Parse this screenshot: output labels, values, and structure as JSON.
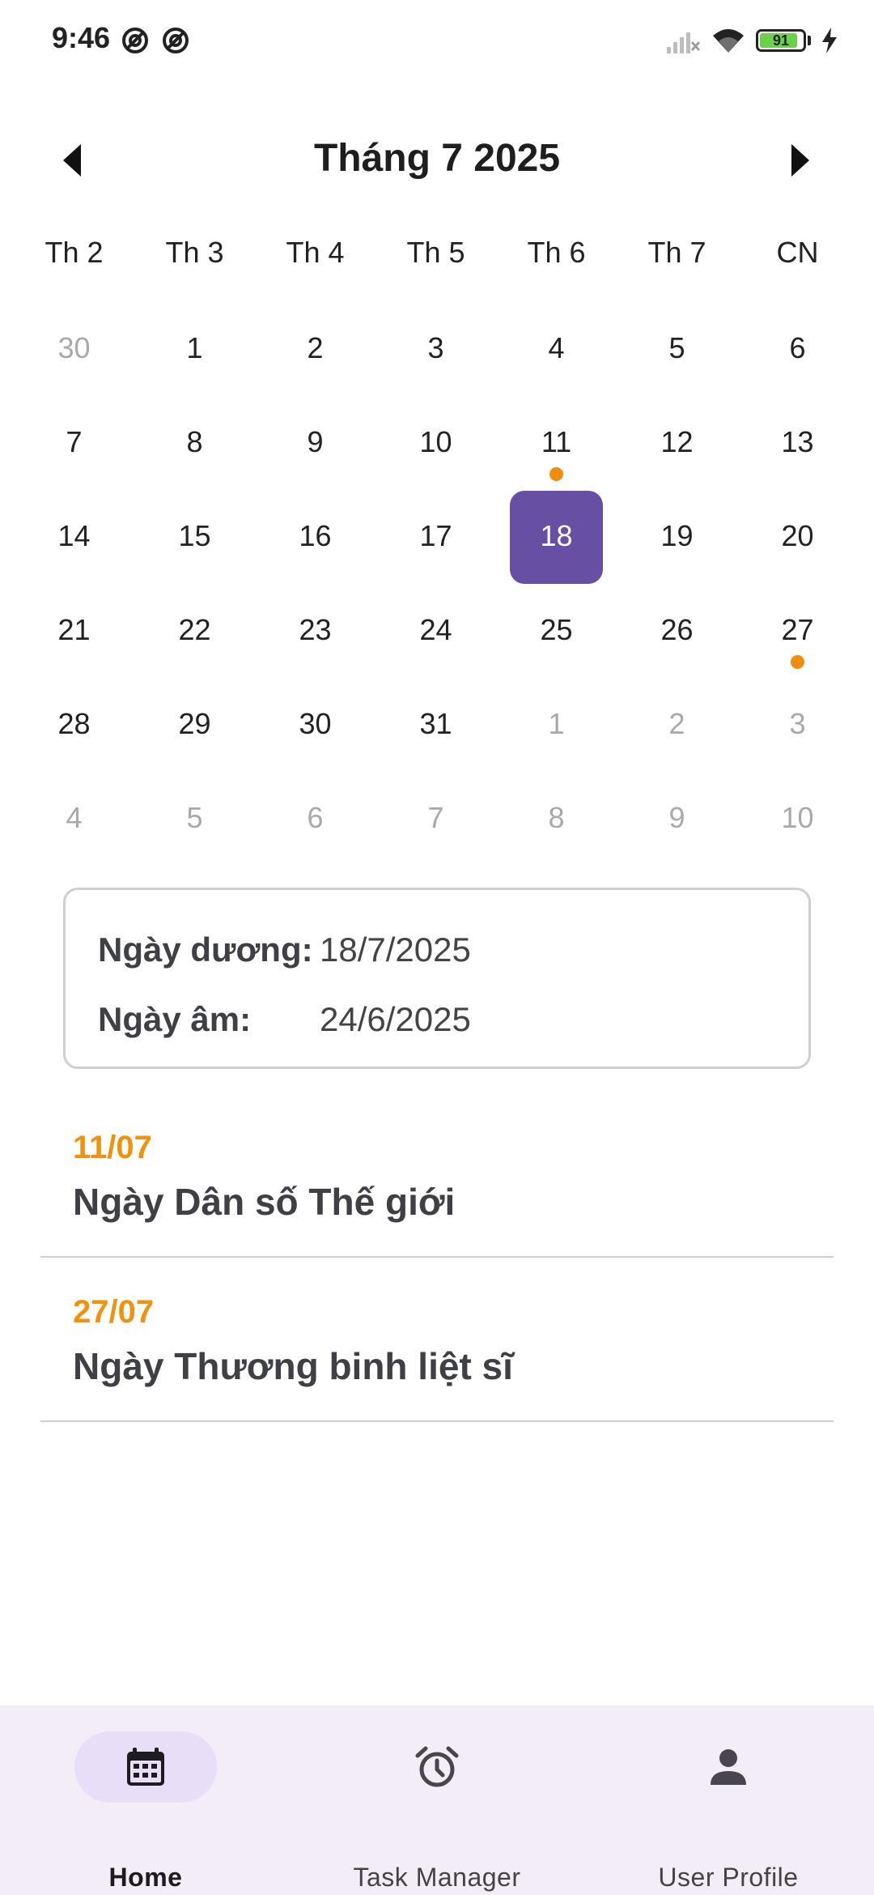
{
  "status_bar": {
    "time": "9:46",
    "battery_level": 91,
    "battery_text": "91",
    "icons": [
      "signal-off-icon",
      "wifi-icon",
      "battery-icon",
      "charging-icon"
    ]
  },
  "calendar": {
    "title": "Tháng 7 2025",
    "prev_icon": "chevron-left-icon",
    "next_icon": "chevron-right-icon",
    "weekdays": [
      "Th 2",
      "Th 3",
      "Th 4",
      "Th 5",
      "Th 6",
      "Th 7",
      "CN"
    ],
    "days": [
      {
        "label": "30",
        "muted": true
      },
      {
        "label": "1"
      },
      {
        "label": "2"
      },
      {
        "label": "3"
      },
      {
        "label": "4"
      },
      {
        "label": "5"
      },
      {
        "label": "6"
      },
      {
        "label": "7"
      },
      {
        "label": "8"
      },
      {
        "label": "9"
      },
      {
        "label": "10"
      },
      {
        "label": "11",
        "event": true
      },
      {
        "label": "12"
      },
      {
        "label": "13"
      },
      {
        "label": "14"
      },
      {
        "label": "15"
      },
      {
        "label": "16"
      },
      {
        "label": "17"
      },
      {
        "label": "18",
        "selected": true
      },
      {
        "label": "19"
      },
      {
        "label": "20"
      },
      {
        "label": "21"
      },
      {
        "label": "22"
      },
      {
        "label": "23"
      },
      {
        "label": "24"
      },
      {
        "label": "25"
      },
      {
        "label": "26"
      },
      {
        "label": "27",
        "event": true
      },
      {
        "label": "28"
      },
      {
        "label": "29"
      },
      {
        "label": "30"
      },
      {
        "label": "31"
      },
      {
        "label": "1",
        "muted": true
      },
      {
        "label": "2",
        "muted": true
      },
      {
        "label": "3",
        "muted": true
      },
      {
        "label": "4",
        "muted": true
      },
      {
        "label": "5",
        "muted": true
      },
      {
        "label": "6",
        "muted": true
      },
      {
        "label": "7",
        "muted": true
      },
      {
        "label": "8",
        "muted": true
      },
      {
        "label": "9",
        "muted": true
      },
      {
        "label": "10",
        "muted": true
      }
    ]
  },
  "date_info": {
    "solar_label": "Ngày dương:",
    "solar_value": "18/7/2025",
    "lunar_label": "Ngày âm:",
    "lunar_value": "24/6/2025"
  },
  "events": [
    {
      "date": "11/07",
      "name": "Ngày Dân số Thế giới"
    },
    {
      "date": "27/07",
      "name": "Ngày Thương binh liệt sĩ"
    }
  ],
  "bottom_nav": [
    {
      "label": "Home",
      "icon": "calendar-icon",
      "active": true
    },
    {
      "label": "Task Manager",
      "icon": "alarm-clock-icon",
      "active": false
    },
    {
      "label": "User Profile",
      "icon": "person-icon",
      "active": false
    }
  ],
  "colors": {
    "accent": "#6750a4",
    "event": "#f38b0c",
    "event_date": "#f0920b",
    "nav_background": "#f3edf7",
    "nav_active_pill": "#e8def8"
  }
}
